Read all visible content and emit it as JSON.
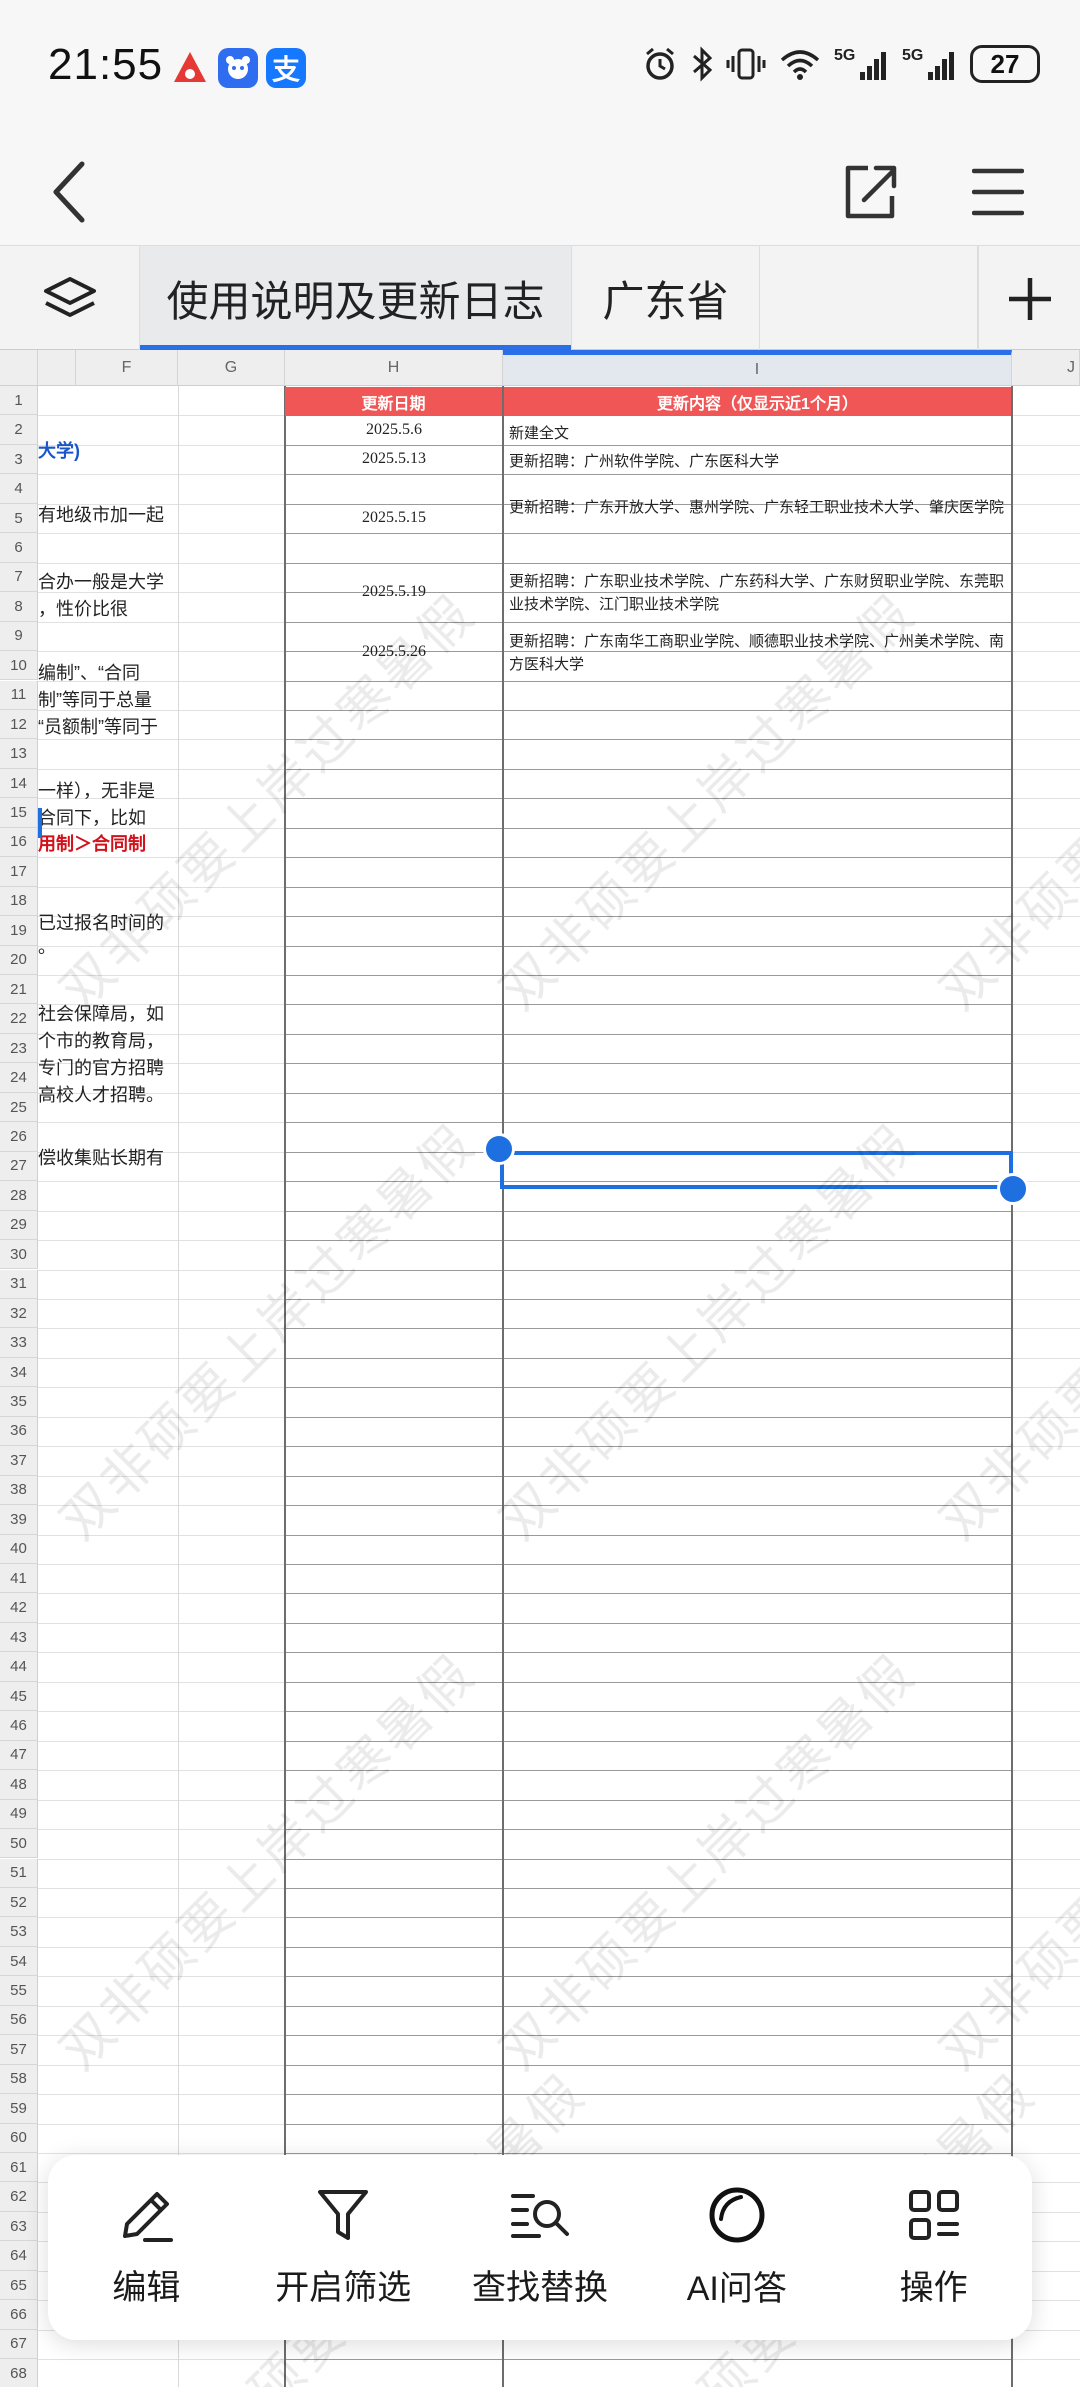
{
  "status_bar": {
    "time": "21:55",
    "battery": "27"
  },
  "tabs": [
    {
      "label": "使用说明及更新日志"
    },
    {
      "label": "广东省"
    }
  ],
  "columns": [
    "F",
    "G",
    "H",
    "I",
    "J"
  ],
  "rows": [
    "1",
    "2",
    "3",
    "4",
    "5",
    "6",
    "7",
    "8",
    "9",
    "10",
    "11",
    "12",
    "13",
    "14",
    "15",
    "16",
    "17",
    "18",
    "19",
    "20",
    "21",
    "22",
    "23",
    "24",
    "25",
    "26",
    "27",
    "28",
    "29",
    "30",
    "31",
    "32",
    "33",
    "34",
    "35",
    "36",
    "37",
    "38",
    "39",
    "40",
    "41",
    "42",
    "43",
    "44",
    "45",
    "46",
    "47",
    "48",
    "49",
    "50",
    "51",
    "52",
    "53",
    "54",
    "55",
    "56",
    "57",
    "58",
    "59",
    "60",
    "61",
    "62",
    "63",
    "64",
    "65",
    "66",
    "67",
    "68"
  ],
  "col_f_text": [
    "大学)",
    "有地级市加一起",
    "合办一般是大学",
    "，性价比很",
    "编制”、“合同",
    "制”等同于总量",
    "“员额制”等同于",
    "一样），无非是",
    "合同下，比如",
    "用制＞合同制",
    "已过报名时间的",
    "。",
    "社会保障局，如",
    "个市的教育局，",
    "专门的官方招聘",
    "高校人才招聘。",
    "偿收集贴长期有"
  ],
  "log": {
    "header_date": "更新日期",
    "header_content": "更新内容（仅显示近1个月）",
    "entries": [
      {
        "date": "2025.5.6",
        "content": "新建全文"
      },
      {
        "date": "2025.5.13",
        "content": "更新招聘：广州软件学院、广东医科大学"
      },
      {
        "date": "2025.5.15",
        "content": "更新招聘：广东开放大学、惠州学院、广东轻工职业技术大学、肇庆医学院"
      },
      {
        "date": "2025.5.19",
        "content": "更新招聘：广东职业技术学院、广东药科大学、广东财贸职业学院、东莞职业技术学院、江门职业技术学院"
      },
      {
        "date": "2025.5.26",
        "content": "更新招聘：广东南华工商职业学院、顺德职业技术学院、广州美术学院、南方医科大学"
      }
    ]
  },
  "watermark": "双非硕要上岸过寒暑假",
  "toolbar": {
    "edit": "编辑",
    "filter": "开启筛选",
    "find_replace": "查找替换",
    "ai": "AI问答",
    "actions": "操作"
  },
  "colors": {
    "accent": "#2a6ee8",
    "header_red": "#f05656",
    "link_blue": "#1a56c9",
    "emphasis_red": "#d0121b"
  }
}
